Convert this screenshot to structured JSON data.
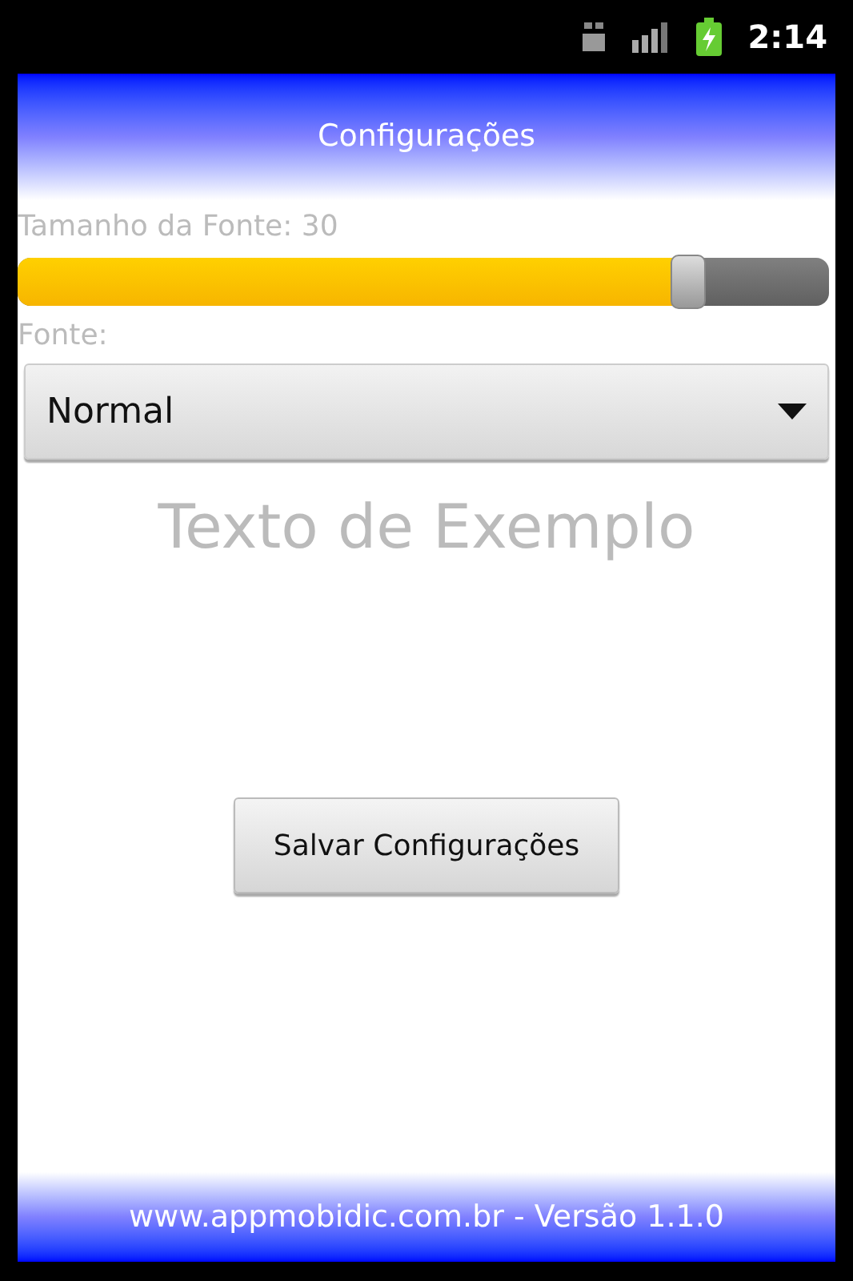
{
  "status_bar": {
    "time": "2:14"
  },
  "title": "Configurações",
  "font_size": {
    "label": "Tamanho da Fonte: 30",
    "level": 0.82
  },
  "font": {
    "label": "Fonte:",
    "value": "Normal"
  },
  "sample_text": "Texto de Exemplo",
  "save_button": "Salvar Configurações",
  "footer": "www.appmobidic.com.br - Versão 1.1.0"
}
